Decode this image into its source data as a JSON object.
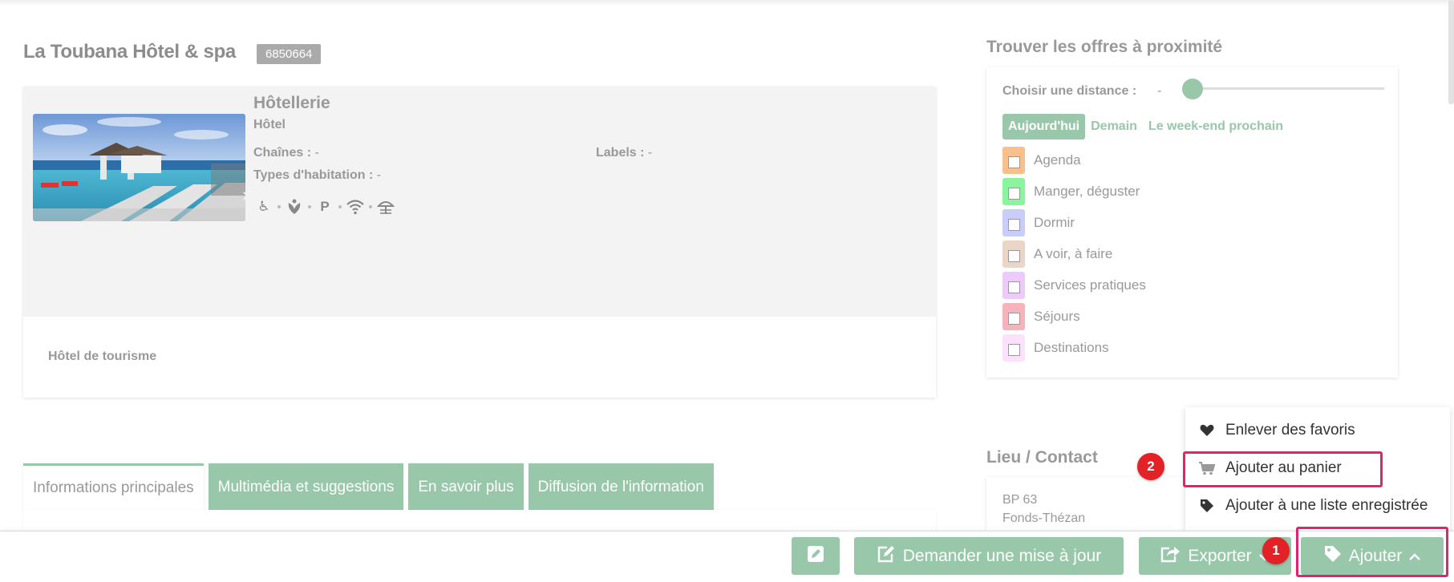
{
  "header": {
    "title": "La Toubana Hôtel & spa",
    "id_badge": "6850664"
  },
  "card": {
    "category": "Hôtellerie",
    "subcategory": "Hôtel",
    "chaines_label": "Chaînes :",
    "chaines_value": "-",
    "labels_label": "Labels :",
    "labels_value": "-",
    "types_label": "Types d'habitation :",
    "types_value": "-",
    "amenities": [
      "wheelchair-icon",
      "spa-icon",
      "parking-icon",
      "wifi-icon",
      "beach-umbrella-icon"
    ],
    "parking_letter": "P",
    "description": "Hôtel de tourisme"
  },
  "tabs": [
    {
      "label": "Informations principales",
      "active": true
    },
    {
      "label": "Multimédia et suggestions",
      "active": false
    },
    {
      "label": "En savoir plus",
      "active": false
    },
    {
      "label": "Diffusion de l'information",
      "active": false
    }
  ],
  "nearby": {
    "title": "Trouver les offres à proximité",
    "distance_label": "Choisir une distance :",
    "distance_value": "-",
    "distance_level": 0,
    "day_tabs": [
      {
        "label": "Aujourd'hui",
        "active": true
      },
      {
        "label": "Demain",
        "active": false
      },
      {
        "label": "Le week-end prochain",
        "active": false
      }
    ],
    "categories": [
      {
        "label": "Agenda",
        "color": "#f9c08e"
      },
      {
        "label": "Manger, déguster",
        "color": "#8af59c"
      },
      {
        "label": "Dormir",
        "color": "#c9cdf9"
      },
      {
        "label": "A voir, à faire",
        "color": "#ead5c6"
      },
      {
        "label": "Services pratiques",
        "color": "#eccbfb"
      },
      {
        "label": "Séjours",
        "color": "#f7b3bb"
      },
      {
        "label": "Destinations",
        "color": "#fbe1fb"
      }
    ]
  },
  "lieu": {
    "title": "Lieu / Contact",
    "line1": "BP 63",
    "line2": "Fonds-Thézan"
  },
  "dropdown": {
    "items": [
      {
        "label": "Enlever des favoris",
        "icon": "heart-icon"
      },
      {
        "label": "Ajouter au panier",
        "icon": "cart-icon"
      },
      {
        "label": "Ajouter à une liste enregistrée",
        "icon": "tag-icon"
      }
    ]
  },
  "markers": {
    "one": "1",
    "two": "2"
  },
  "toolbar": {
    "update_label": "Demander une mise à jour",
    "export_label": "Exporter",
    "add_label": "Ajouter"
  },
  "colors": {
    "accent": "#98c7aa",
    "highlight": "#e0246e",
    "marker": "#e32227"
  }
}
